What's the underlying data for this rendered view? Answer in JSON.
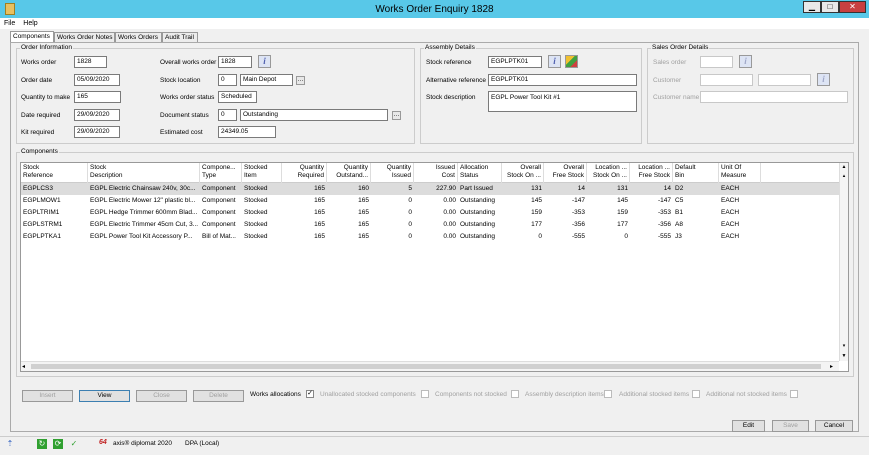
{
  "window": {
    "title": "Works Order Enquiry 1828",
    "min": "▁",
    "max": "□",
    "close": "✕"
  },
  "menu": [
    "File",
    "Help"
  ],
  "tabs": [
    "Components",
    "Works Order Notes",
    "Works Orders",
    "Audit Trail"
  ],
  "order_info": {
    "group_label": "Order Information",
    "works_order_label": "Works order",
    "works_order": "1828",
    "order_date_label": "Order date",
    "order_date": "05/09/2020",
    "qty_label": "Quantity to make",
    "qty": "165",
    "date_required_label": "Date required",
    "date_required": "29/09/2020",
    "kit_required_label": "Kit required",
    "kit_required": "29/09/2020",
    "overall_wo_label": "Overall works order",
    "overall_wo": "1828",
    "stock_location_label": "Stock location",
    "stock_location_code": "0",
    "stock_location": "Main Depot",
    "wo_status_label": "Works order status",
    "wo_status": "Scheduled",
    "doc_status_label": "Document status",
    "doc_status_code": "0",
    "doc_status": "Outstanding",
    "est_cost_label": "Estimated cost",
    "est_cost": "24349.05"
  },
  "assembly": {
    "group_label": "Assembly Details",
    "stock_ref_label": "Stock reference",
    "stock_ref": "EGPLPTK01",
    "alt_ref_label": "Alternative reference",
    "alt_ref": "EGPLPTK01",
    "stock_desc_label": "Stock description",
    "stock_desc": "EGPL Power Tool Kit #1"
  },
  "sales_order": {
    "group_label": "Sales Order Details",
    "sales_order_label": "Sales order",
    "customer_label": "Customer",
    "customer_name_label": "Customer name"
  },
  "components": {
    "group_label": "Components",
    "columns": [
      "Stock\nReference",
      "Stock\nDescription",
      "Compone...\nType",
      "Stocked\nItem",
      "Quantity\nRequired",
      "Quantity\nOutstand...",
      "Quantity\nIssued",
      "Issued\nCost",
      "Allocation\nStatus",
      "Overall\nStock On ...",
      "Overall\nFree Stock",
      "Location ...\nStock On ...",
      "Location ...\nFree Stock",
      "Default\nBin",
      "Unit Of\nMeasure"
    ],
    "rows": [
      [
        "EGPLCS3",
        "EGPL Electric Chainsaw 240v, 30c...",
        "Component",
        "Stocked",
        "165",
        "160",
        "5",
        "227.90",
        "Part Issued",
        "131",
        "14",
        "131",
        "14",
        "D2",
        "EACH"
      ],
      [
        "EGPLMOW1",
        "EGPL Electric Mower 12\" plastic bl...",
        "Component",
        "Stocked",
        "165",
        "165",
        "0",
        "0.00",
        "Outstanding",
        "145",
        "-147",
        "145",
        "-147",
        "C5",
        "EACH"
      ],
      [
        "EGPLTRIM1",
        "EGPL Hedge Trimmer 600mm Blad...",
        "Component",
        "Stocked",
        "165",
        "165",
        "0",
        "0.00",
        "Outstanding",
        "159",
        "-353",
        "159",
        "-353",
        "B1",
        "EACH"
      ],
      [
        "EGPLSTRM1",
        "EGPL Electric Trimmer 45cm Cut, 3...",
        "Component",
        "Stocked",
        "165",
        "165",
        "0",
        "0.00",
        "Outstanding",
        "177",
        "-356",
        "177",
        "-356",
        "A8",
        "EACH"
      ],
      [
        "EGPLPTKA1",
        "EGPL Power Tool Kit Accessory P...",
        "Bill of Mat...",
        "Stocked",
        "165",
        "165",
        "0",
        "0.00",
        "Outstanding",
        "0",
        "-555",
        "0",
        "-555",
        "J3",
        "EACH"
      ]
    ]
  },
  "actions": {
    "insert": "Insert",
    "view": "View",
    "close": "Close",
    "delete": "Delete",
    "works_alloc": "Works allocations"
  },
  "filters": [
    "Unallocated stocked components",
    "Components not stocked",
    "Assembly description items",
    "Additional stocked items",
    "Additional not stocked items"
  ],
  "footer": {
    "edit": "Edit",
    "save": "Save",
    "cancel": "Cancel"
  },
  "status": {
    "brand": "axis® diplomat 2020",
    "db": "DPA (Local)",
    "logo": "64"
  }
}
